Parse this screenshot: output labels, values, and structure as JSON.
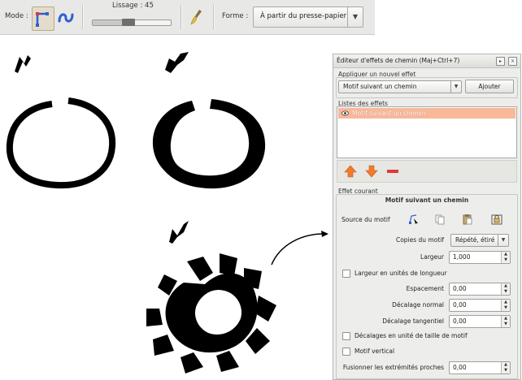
{
  "toolbar": {
    "mode_label": "Mode :",
    "smoothing_label": "Lissage : 45",
    "smoothing_value": 0.45,
    "shape_label": "Forme :",
    "shape_value": "À partir du presse-papier"
  },
  "dialog": {
    "title": "Éditeur d'effets de chemin (Maj+Ctrl+7)",
    "apply_section": "Appliquer un nouvel effet",
    "effect_select": "Motif suivant un chemin",
    "add_button": "Ajouter",
    "list_section": "Listes des effets",
    "effects_list": [
      "Motif suivant un chemin"
    ],
    "current_section": "Effet courant",
    "current_effect_title": "Motif suivant un chemin",
    "source_label": "Source du motif",
    "copies_label": "Copies du motif",
    "copies_value": "Répété, étiré",
    "width_label": "Largeur",
    "width_value": "1,000",
    "width_units_label": "Largeur en unités de longueur",
    "spacing_label": "Espacement",
    "spacing_value": "0,00",
    "normal_offset_label": "Décalage normal",
    "normal_offset_value": "0,00",
    "tangent_offset_label": "Décalage tangentiel",
    "tangent_offset_value": "0,00",
    "offset_units_label": "Décalages en unité de taille de motif",
    "vertical_label": "Motif vertical",
    "fuse_label": "Fusionner les extrémités proches",
    "fuse_value": "0,00"
  },
  "colors": {
    "accent_selection": "#f8b89a",
    "up_arrow": "#f07a2e",
    "delete": "#e0383a",
    "mode_icon": "#2f5fd0"
  }
}
